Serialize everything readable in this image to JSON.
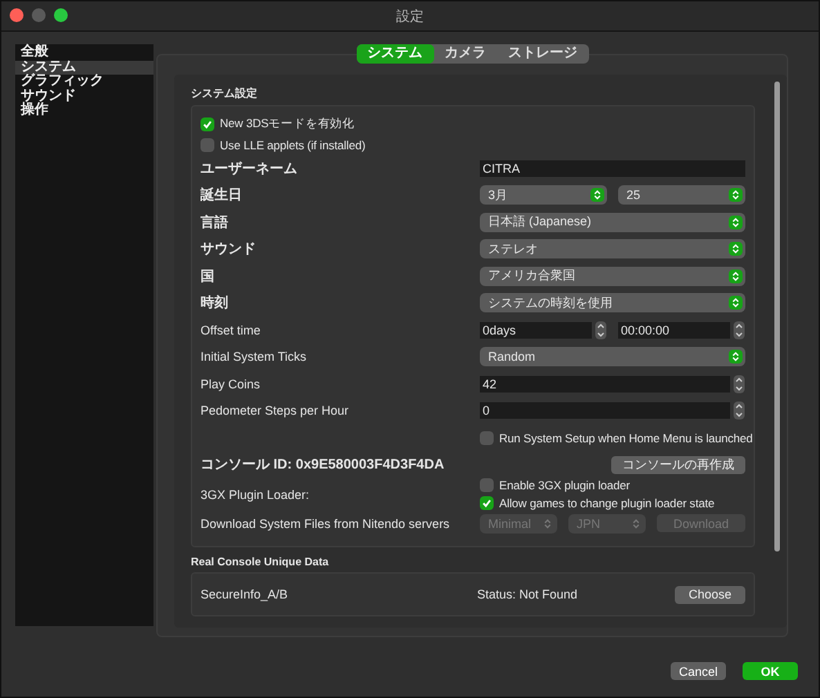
{
  "window": {
    "title": "設定"
  },
  "sidebar": {
    "items": [
      {
        "label": "全般",
        "selected": false
      },
      {
        "label": "システム",
        "selected": true
      },
      {
        "label": "グラフィック",
        "selected": false
      },
      {
        "label": "サウンド",
        "selected": false
      },
      {
        "label": "操作",
        "selected": false
      }
    ]
  },
  "tabs": [
    {
      "label": "システム",
      "selected": true
    },
    {
      "label": "カメラ",
      "selected": false
    },
    {
      "label": "ストレージ",
      "selected": false
    }
  ],
  "system_settings": {
    "title": "システム設定",
    "rows": [
      {
        "kind": "option",
        "controls": [
          {
            "kind": "checkbox",
            "label": "New 3DSモードを有効化",
            "checked": true
          }
        ]
      },
      {
        "kind": "option",
        "controls": [
          {
            "kind": "checkbox",
            "label": "Use LLE applets (if installed)",
            "checked": false
          }
        ]
      },
      {
        "kind": "setting",
        "label": "ユーザーネーム",
        "controls": [
          {
            "kind": "field",
            "value": "CITRA"
          }
        ]
      },
      {
        "kind": "setting",
        "label": "誕生日",
        "controls": [
          {
            "kind": "select",
            "value": "3月",
            "disabled": false
          },
          {
            "kind": "select",
            "value": "25",
            "disabled": false
          }
        ]
      },
      {
        "kind": "setting",
        "label": "言語",
        "controls": [
          {
            "kind": "select",
            "value": "日本語 (Japanese)",
            "disabled": false
          }
        ]
      },
      {
        "kind": "setting",
        "label": "サウンド",
        "controls": [
          {
            "kind": "select",
            "value": "ステレオ",
            "disabled": false
          }
        ]
      },
      {
        "kind": "setting",
        "label": "国",
        "controls": [
          {
            "kind": "select",
            "value": "アメリカ合衆国",
            "disabled": false
          }
        ]
      },
      {
        "kind": "setting",
        "label": "時刻",
        "controls": [
          {
            "kind": "select",
            "value": "システムの時刻を使用",
            "disabled": false
          }
        ]
      },
      {
        "kind": "setting",
        "label": "Offset time",
        "controls": [
          {
            "kind": "spin",
            "value": "0days"
          },
          {
            "kind": "spin",
            "value": "00:00:00"
          }
        ]
      },
      {
        "kind": "setting",
        "label": "Initial System Ticks",
        "controls": [
          {
            "kind": "select",
            "value": "Random",
            "disabled": false
          }
        ]
      },
      {
        "kind": "setting",
        "label": "Play Coins",
        "controls": [
          {
            "kind": "spin",
            "value": "42"
          }
        ]
      },
      {
        "kind": "setting",
        "label": "Pedometer Steps per Hour",
        "controls": [
          {
            "kind": "spin",
            "value": "0"
          }
        ]
      },
      {
        "kind": "setting",
        "controls": [
          {
            "kind": "checkbox",
            "label": "Run System Setup when Home Menu is launched",
            "checked": false
          }
        ]
      },
      {
        "kind": "setting",
        "label": "コンソール ID: 0x9E580003F4D3F4DA",
        "controls": [
          {
            "kind": "button",
            "label": "コンソールの再作成",
            "disabled": false
          }
        ]
      },
      {
        "kind": "setting",
        "label": "3GX Plugin Loader:",
        "controls": [
          {
            "kind": "checkbox",
            "label": "Enable 3GX plugin loader",
            "checked": false
          },
          {
            "kind": "checkbox",
            "label": "Allow games to change plugin loader state",
            "checked": true
          }
        ]
      },
      {
        "kind": "setting",
        "label": "Download System Files from Nitendo servers",
        "controls": [
          {
            "kind": "select",
            "value": "Minimal",
            "disabled": true
          },
          {
            "kind": "select",
            "value": "JPN",
            "disabled": true
          },
          {
            "kind": "button",
            "label": "Download",
            "disabled": true
          }
        ]
      }
    ]
  },
  "real_console": {
    "title": "Real Console Unique Data",
    "rows": [
      {
        "label": "SecureInfo_A/B",
        "status": "Status: Not Found",
        "button": "Choose"
      }
    ]
  },
  "buttons": [
    {
      "label": "Cancel",
      "kind": "secondary"
    },
    {
      "label": "OK",
      "kind": "primary"
    }
  ]
}
